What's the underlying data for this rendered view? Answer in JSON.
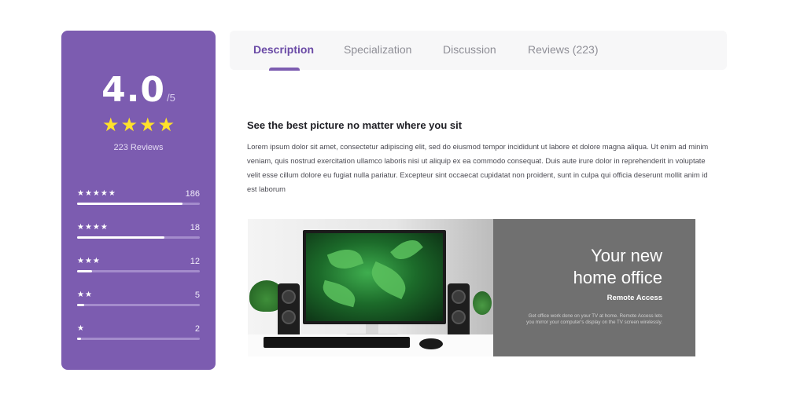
{
  "rating": {
    "score": "4.0",
    "out_of": "/5",
    "stars": 4,
    "reviews_label": "223 Reviews",
    "breakdown": [
      {
        "stars": 5,
        "stars_text": "★★★★★",
        "count": "186",
        "fraction": 0.86
      },
      {
        "stars": 4,
        "stars_text": "★★★★",
        "count": "18",
        "fraction": 0.71
      },
      {
        "stars": 3,
        "stars_text": "★★★",
        "count": "12",
        "fraction": 0.12
      },
      {
        "stars": 2,
        "stars_text": "★★",
        "count": "5",
        "fraction": 0.06
      },
      {
        "stars": 1,
        "stars_text": "★",
        "count": "2",
        "fraction": 0.03
      }
    ]
  },
  "tabs": [
    {
      "label": "Description",
      "active": true
    },
    {
      "label": "Specialization",
      "active": false
    },
    {
      "label": "Discussion",
      "active": false
    },
    {
      "label": "Reviews (223)",
      "active": false
    }
  ],
  "description": {
    "heading": "See the best picture no matter where you sit",
    "body": "Lorem ipsum dolor sit amet, consectetur adipiscing elit, sed do eiusmod tempor incididunt ut labore et dolore magna aliqua. Ut enim ad minim veniam, quis nostrud exercitation ullamco laboris nisi ut aliquip ex ea commodo consequat. Duis aute irure dolor in reprehenderit in voluptate velit esse cillum dolore eu fugiat nulla pariatur. Excepteur sint occaecat cupidatat non proident, sunt in culpa qui officia deserunt mollit anim id est laborum"
  },
  "banner": {
    "title_line1": "Your new",
    "title_line2": "home office",
    "subtitle": "Remote Access",
    "small_text": "Get office work done on your TV at home. Remote Access lets you mirror your computer's display on the TV screen wirelessly."
  },
  "colors": {
    "card_bg": "#7c5cb0",
    "star_yellow": "#ffe12a",
    "tab_active": "#6a4aa6",
    "banner_panel": "#707070"
  }
}
